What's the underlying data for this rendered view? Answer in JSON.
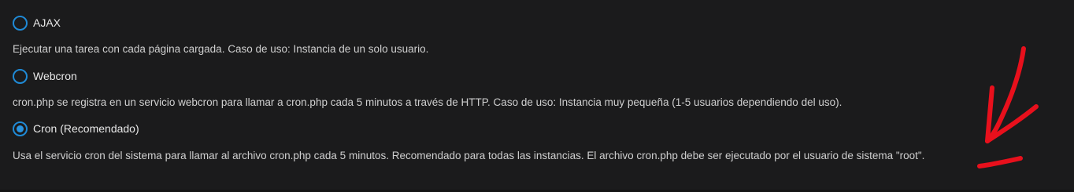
{
  "cron_settings": {
    "options": [
      {
        "label": "AJAX",
        "checked": false,
        "description": "Ejecutar una tarea con cada página cargada. Caso de uso: Instancia de un solo usuario."
      },
      {
        "label": "Webcron",
        "checked": false,
        "description": "cron.php se registra en un servicio webcron para llamar a cron.php cada 5 minutos a través de HTTP. Caso de uso: Instancia muy pequeña (1-5 usuarios dependiendo del uso)."
      },
      {
        "label": "Cron (Recomendado)",
        "checked": true,
        "description": "Usa el servicio cron del sistema para llamar al archivo cron.php cada 5 minutos. Recomendado para todas las instancias. El archivo cron.php debe ser ejecutado por el usuario de sistema \"root\"."
      }
    ]
  },
  "colors": {
    "background": "#1b1b1c",
    "radio_accent": "#1f8ad6",
    "annotation_red": "#e8101c"
  },
  "annotation": {
    "icon": "red-arrow-icon"
  }
}
